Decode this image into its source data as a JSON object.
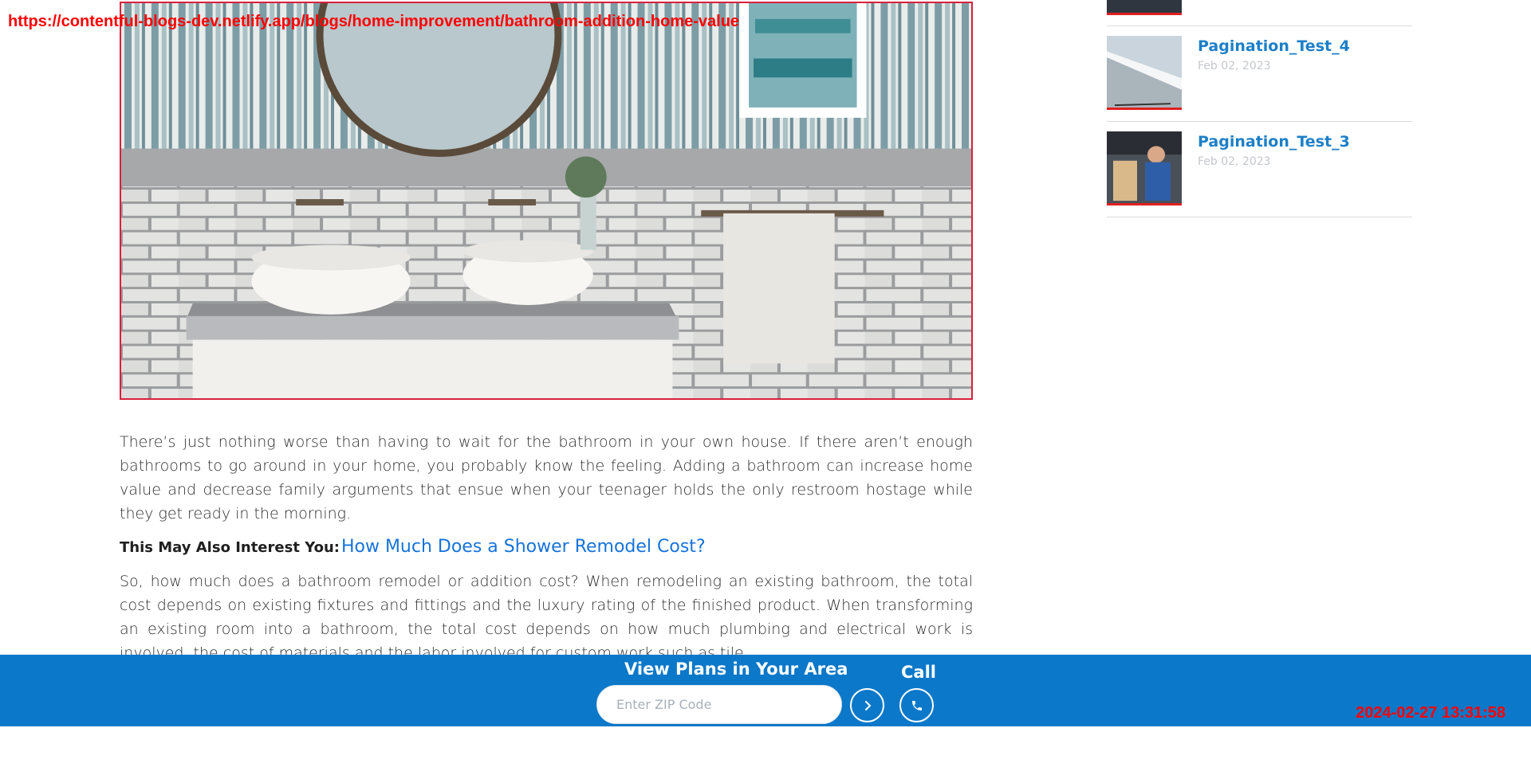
{
  "overlay": {
    "url": "https://contentful-blogs-dev.netlify.app/blogs/home-improvement/bathroom-addition-home-value",
    "timestamp": "2024-02-27 13:31:58"
  },
  "hero": {
    "alt": "Bathroom with double vanity and striped wallpaper"
  },
  "article": {
    "paragraph_1": "There’s just nothing worse than having to wait for the bathroom in your own house. If there aren’t enough bathrooms to go around in your home, you probably know the feeling. Adding a bathroom can increase home value and decrease family arguments that ensue when your teenager holds the only restroom hostage while they get ready in the morning.",
    "interest_label": "This May Also Interest You:",
    "interest_link": "How Much Does a Shower Remodel Cost?",
    "paragraph_2": "So, how much does a bathroom remodel or addition cost? When remodeling an existing bathroom, the total cost depends on existing fixtures and fittings and the luxury rating of the finished product. When transforming an existing room into a bathroom, the total cost depends on how much plumbing and electrical work is involved, the cost of materials and the labor involved for custom work such as tile."
  },
  "sidebar": {
    "items": [
      {
        "title": "Pagination_Test_4",
        "date": "Feb 02, 2023",
        "thumb_icon": "house-eave-thumbnail"
      },
      {
        "title": "Pagination_Test_3",
        "date": "Feb 02, 2023",
        "thumb_icon": "technician-thumbnail"
      }
    ]
  },
  "cta": {
    "title": "View Plans in Your Area",
    "zip_placeholder": "Enter ZIP Code",
    "go_icon": "chevron-right-icon",
    "call_label": "Call",
    "call_icon": "phone-icon"
  },
  "colors": {
    "cta_background": "#0b78c9",
    "link_blue": "#1673d9",
    "sidebar_title": "#1c7fc7",
    "thumb_underline": "#e02020",
    "overlay_red": "#ff0000"
  }
}
